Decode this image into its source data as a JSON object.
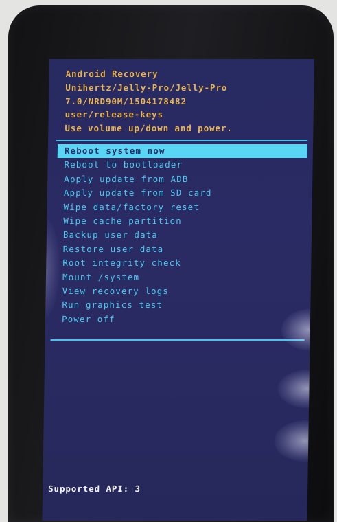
{
  "recovery": {
    "header_lines": [
      "Android Recovery",
      "Unihertz/Jelly-Pro/Jelly-Pro",
      "7.0/NRD90M/1504178482",
      "user/release-keys",
      "Use volume up/down and power."
    ],
    "menu_items": [
      "Reboot system now",
      "Reboot to bootloader",
      "Apply update from ADB",
      "Apply update from SD card",
      "Wipe data/factory reset",
      "Wipe cache partition",
      "Backup user data",
      "Restore user data",
      "Root integrity check",
      "Mount /system",
      "View recovery logs",
      "Run graphics test",
      "Power off"
    ],
    "selected_item": "Reboot system now",
    "footer": "Supported API: 3"
  },
  "colors": {
    "screen_background": "#2a2b63",
    "header_text": "#e9b34d",
    "menu_text": "#49c9ef",
    "highlight_background": "#58d6f4",
    "divider": "#46c4ee",
    "footer_text": "#f2f2f6"
  }
}
